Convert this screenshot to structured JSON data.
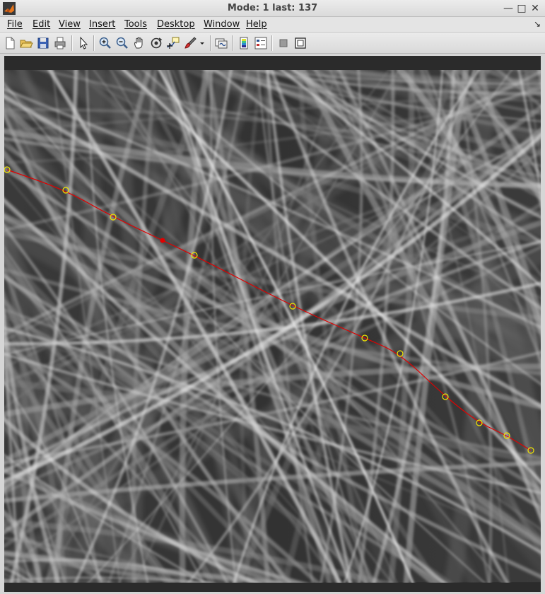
{
  "window": {
    "title": "Mode: 1 last: 137",
    "minimize_glyph": "—",
    "maximize_glyph": "□",
    "close_glyph": "✕",
    "app_icon": "matlab-logo-icon"
  },
  "menubar": {
    "items": [
      {
        "label": "File",
        "mnemonic": "F"
      },
      {
        "label": "Edit",
        "mnemonic": "E"
      },
      {
        "label": "View",
        "mnemonic": "V"
      },
      {
        "label": "Insert",
        "mnemonic": "I"
      },
      {
        "label": "Tools",
        "mnemonic": "T"
      },
      {
        "label": "Desktop",
        "mnemonic": "D"
      },
      {
        "label": "Window",
        "mnemonic": "W"
      },
      {
        "label": "Help",
        "mnemonic": "H"
      }
    ],
    "dock_glyph": "↘"
  },
  "toolbar": {
    "buttons": [
      "new-figure-icon",
      "open-file-icon",
      "save-icon",
      "print-icon",
      "edit-plot-arrow-icon",
      "zoom-in-icon",
      "zoom-out-icon",
      "pan-hand-icon",
      "rotate-3d-icon",
      "data-cursor-icon",
      "brush-icon",
      "brush-dropdown-icon",
      "link-plot-icon",
      "colorbar-icon",
      "legend-icon",
      "hide-plot-tools-icon",
      "show-plot-tools-icon"
    ]
  },
  "colors": {
    "trace_line": "#e00000",
    "control_point": "#f2e600",
    "selected_point": "#e00000",
    "image_background": "#2c2c2c"
  },
  "image": {
    "content": "grayscale microscopy image of overlapping fibers",
    "traced_path": {
      "control_point_count": 11,
      "selected_point_count": 1
    }
  }
}
